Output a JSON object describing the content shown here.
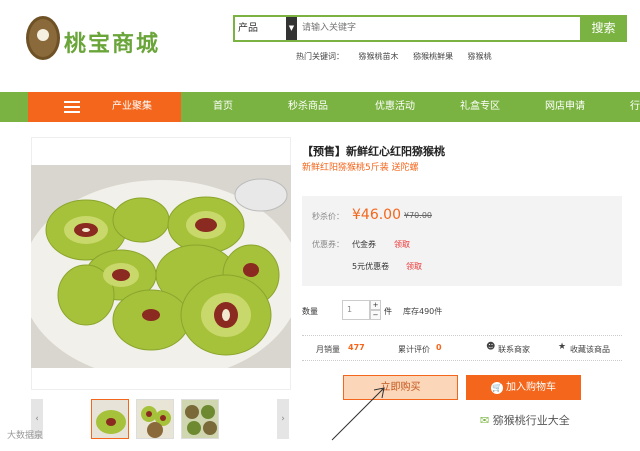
{
  "header": {
    "logo_text": "桃宝商城",
    "search": {
      "category": "产品",
      "placeholder": "请输入关键字",
      "button": "搜索"
    },
    "hot_label": "热门关键词：",
    "hot_keywords": [
      "猕猴桃苗木",
      "猕猴桃鲜果",
      "猕猴桃"
    ]
  },
  "nav": {
    "category_label": "产业聚集",
    "items": [
      "首页",
      "秒杀商品",
      "优惠活动",
      "礼盒专区",
      "网店申请",
      "行"
    ]
  },
  "product": {
    "title": "【预售】新鲜红心红阳猕猴桃",
    "subtitle": "新鲜红阳猕猴桃5斤装 送陀螺",
    "price_label": "秒杀价：",
    "price": "¥46.00",
    "old_price": "¥70.00",
    "coupon_label": "优惠券：",
    "coupons": [
      {
        "name": "代金券",
        "action": "领取"
      },
      {
        "name": "5元优惠卷",
        "action": "领取"
      }
    ],
    "qty_label": "数量",
    "qty": "1",
    "qty_plus": "+",
    "qty_minus": "−",
    "unit": "件",
    "stock": "库存490件",
    "sales_label": "月销量",
    "sales": "477",
    "reviews_label": "累计评价",
    "reviews": "0",
    "contact": "联系商家",
    "favorite": "收藏该商品",
    "buy_now": "立即购买",
    "add_cart": "加入购物车",
    "thumb_prev": "‹",
    "thumb_next": "›"
  },
  "watermarks": {
    "left": "大数据泉",
    "right": "猕猴桃行业大全"
  },
  "colors": {
    "green": "#7ab341",
    "orange": "#f4661b"
  }
}
